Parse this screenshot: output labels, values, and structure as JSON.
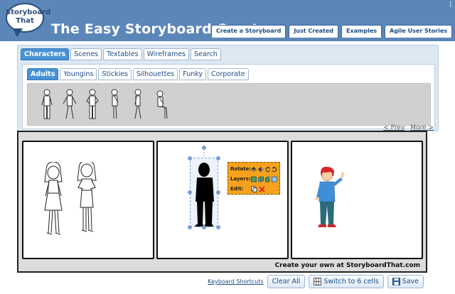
{
  "header": {
    "logo_line1": "Storyboard",
    "logo_line2": "That",
    "title": "The Easy Storyboard Creator",
    "corner_mark": "[",
    "nav": [
      "Create a Storyboard",
      "Just Created",
      "Examples",
      "Agile User Stories"
    ]
  },
  "library": {
    "main_tabs": [
      {
        "label": "Characters",
        "active": true
      },
      {
        "label": "Scenes",
        "active": false
      },
      {
        "label": "Textables",
        "active": false
      },
      {
        "label": "Wireframes",
        "active": false
      },
      {
        "label": "Search",
        "active": false
      }
    ],
    "sub_tabs": [
      {
        "label": "Adults",
        "active": true
      },
      {
        "label": "Youngins",
        "active": false
      },
      {
        "label": "Stickies",
        "active": false
      },
      {
        "label": "Silhouettes",
        "active": false
      },
      {
        "label": "Funky",
        "active": false
      },
      {
        "label": "Corporate",
        "active": false
      }
    ],
    "figure_count": 6,
    "pager": {
      "prev": "< Prev",
      "more": "More >"
    }
  },
  "storyboard": {
    "cells": 3,
    "watermark": "Create your own at StoryboardThat.com",
    "toolbox": {
      "rotate": "Rotate:",
      "layers": "Layers:",
      "edit": "Edit:"
    }
  },
  "actions": {
    "keyboard": "Keyboard Shortcuts",
    "clear": "Clear All",
    "switch": "Switch to 6 cells",
    "save": "Save"
  },
  "colors": {
    "header_bg": "#5b86b8",
    "tab_active": "#4a92d4",
    "toolbox": "#f6a21e",
    "nav_text": "#1c4c84"
  }
}
